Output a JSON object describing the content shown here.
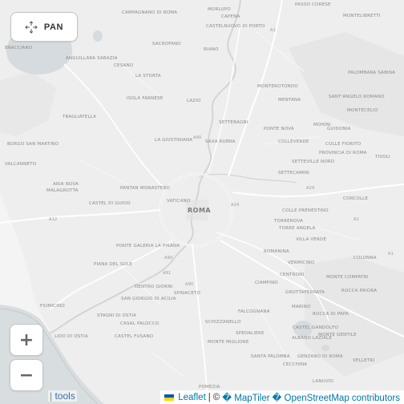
{
  "controls": {
    "pan_label": "PAN",
    "zoom_in_label": "+",
    "zoom_out_label": "−",
    "tools_separator": "|",
    "tools_label": "tools"
  },
  "attribution": {
    "leaflet": "Leaflet",
    "separator": "|",
    "copyright_prefix": "©",
    "maptiler": "� MapTiler",
    "osm": "� OpenStreetMap contributors"
  },
  "map": {
    "city_label": "ROMA",
    "place_labels": {
      "campagnano": "CAMPAGNANO DI ROMA",
      "morlupo": "MORLUPO",
      "capena": "CAPENA",
      "passo_corese": "PASSO CORESE",
      "montelibretti": "MONTELIBRETTI",
      "castelnuovo": "CASTELNUOVO DI PORTO",
      "riano": "RIANO",
      "sacrofano": "SACROFANO",
      "bracciano": "BRACCIANO",
      "anguillara": "ANGUILLARA SABAZIA",
      "cesano": "CESANO",
      "la_storta": "LA STORTA",
      "isola_farnese": "ISOLA FARNESE",
      "lazio": "LAZIO",
      "settebagni": "SETTEBAGNI",
      "monterotondo": "MONTEROTONDO",
      "mentana": "MENTANA",
      "palombara": "PALOMBARA SABINA",
      "santangelo": "SANT'ANGELO ROMANO",
      "montecelio": "MONTECELIO",
      "trigliatella": "TRAGLIATELLA",
      "la_giustiniana": "LA GIUSTINIANA",
      "saxa_rubra": "SAXA RUBRA",
      "ponte_nova": "PONTE NOVA",
      "mohini": "MOHINI",
      "guidonia": "GUIDONIA",
      "colleverde": "COLLEVERDE",
      "colle_fiorito": "COLLE FIORITO",
      "provincia_di_roma": "PROVINCIA DI ROMA",
      "tivoli": "TIVOLI",
      "borgo_san_martino": "BORGO SAN MARTINO",
      "valcanneto": "VALCANNETO",
      "settecamini": "SETTECAMINI",
      "setteville_nord": "SETTEVILLE NORD",
      "aria_nova": "ARIA NOVA",
      "malagrotta": "MALAGROTTA",
      "pantan_monastero": "PANTAN MONASTERO",
      "vaticano": "VATICANO",
      "corcolle": "CORCOLLE",
      "castel_di_guido": "CASTEL DI GUIDO",
      "colle_prenestino": "COLLE PRENESTINO",
      "tor_bella_monaca": "TORRENOVA",
      "torre_angela": "TORRE ANGELA",
      "villa_verde": "VILLA VERDE",
      "ponte_galeria": "PONTE GALERIA LA PISANA",
      "piana_del_sole": "PIANA DEL SOLE",
      "romanina": "ROMANINA",
      "colonna": "COLONNA",
      "vermicino": "VERMICINO",
      "centroni": "CENTRONI",
      "monte_compatri": "MONTE COMPATRI",
      "dentro_giorni": "DENTRO GIORNI",
      "spinaceto": "SPINACETO",
      "ciampino": "CIAMPINO",
      "grottaferrata": "GROTTAFERRATA",
      "rocca_priora": "ROCCA PRIORA",
      "fiumicino": "FIUMICINO",
      "san_giorgio": "SAN GIORGIO DI ACILIA",
      "stagni_di_ostia": "STAGNI DI OSTIA",
      "casal_palocco": "CASAL PALOCCO",
      "marino": "MARINO",
      "rocca_di_papa": "ROCCA DI PAPA",
      "falcognana": "FALCOGNANA",
      "castel_gandolfo": "CASTEL GANDOLFO",
      "monte_gentile": "MONTE GENTILE",
      "lido_di_ostia": "LIDO DI OSTIA",
      "castel_fusano": "CASTEL FUSANO",
      "schizzanello": "SCHIZZANELLO",
      "spedaliere": "SPEDALIERE",
      "albano": "ALBANO LAZIALE",
      "monte_migliore": "MONTE MIGLIORE",
      "santa_palomba": "SANTA PALOMBA",
      "genzano": "GENZANO DI ROMA",
      "velletri": "VELLETRI",
      "cecchina": "CECCHINA",
      "pomezia": "POMEZIA",
      "lanuvio": "LANUVIO"
    },
    "road_labels": {
      "a1_n": "A1",
      "a1_e": "A1",
      "a90_nw": "A90",
      "a24": "A24",
      "a24_b": "A24",
      "a90_w": "A90",
      "a91": "A91",
      "a1_se": "A1",
      "a12": "A12",
      "a90_s": "A90"
    }
  }
}
